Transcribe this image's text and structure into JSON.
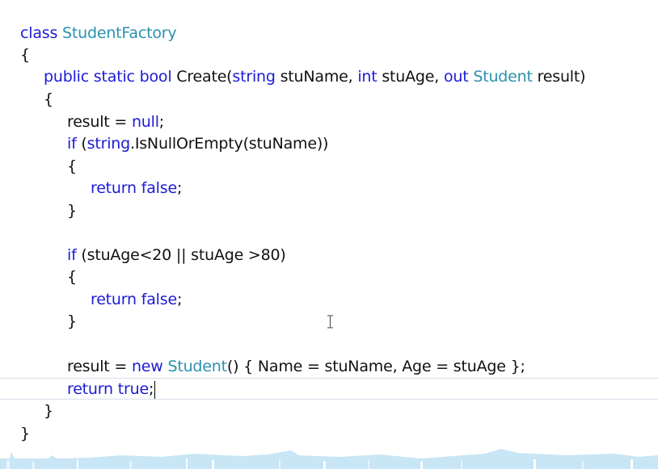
{
  "editor": {
    "lines": [
      [
        {
          "t": "class ",
          "k": "keyword"
        },
        {
          "t": "StudentFactory",
          "k": "type"
        }
      ],
      [
        {
          "t": "{",
          "k": "plain"
        }
      ],
      [
        {
          "t": "public static bool ",
          "k": "keyword"
        },
        {
          "t": "Create(",
          "k": "plain"
        },
        {
          "t": "string ",
          "k": "keyword"
        },
        {
          "t": "stuName, ",
          "k": "plain"
        },
        {
          "t": "int ",
          "k": "keyword"
        },
        {
          "t": "stuAge, ",
          "k": "plain"
        },
        {
          "t": "out ",
          "k": "keyword"
        },
        {
          "t": "Student ",
          "k": "type"
        },
        {
          "t": "result)",
          "k": "plain"
        }
      ],
      [
        {
          "t": "{",
          "k": "plain"
        }
      ],
      [
        {
          "t": "result = ",
          "k": "plain"
        },
        {
          "t": "null",
          "k": "keyword"
        },
        {
          "t": ";",
          "k": "plain"
        }
      ],
      [
        {
          "t": "if ",
          "k": "keyword"
        },
        {
          "t": "(",
          "k": "plain"
        },
        {
          "t": "string",
          "k": "keyword"
        },
        {
          "t": ".IsNullOrEmpty(stuName))",
          "k": "plain"
        }
      ],
      [
        {
          "t": "{",
          "k": "plain"
        }
      ],
      [
        {
          "t": "return false",
          "k": "keyword"
        },
        {
          "t": ";",
          "k": "plain"
        }
      ],
      [
        {
          "t": "}",
          "k": "plain"
        }
      ],
      [],
      [
        {
          "t": "if ",
          "k": "keyword"
        },
        {
          "t": "(stuAge<20 || stuAge >80)",
          "k": "plain"
        }
      ],
      [
        {
          "t": "{",
          "k": "plain"
        }
      ],
      [
        {
          "t": "return false",
          "k": "keyword"
        },
        {
          "t": ";",
          "k": "plain"
        }
      ],
      [
        {
          "t": "}",
          "k": "plain"
        }
      ],
      [],
      [
        {
          "t": "result = ",
          "k": "plain"
        },
        {
          "t": "new ",
          "k": "keyword"
        },
        {
          "t": "Student",
          "k": "type"
        },
        {
          "t": "() { Name = stuName, Age = stuAge };",
          "k": "plain"
        }
      ],
      [
        {
          "t": "return true",
          "k": "keyword"
        },
        {
          "t": ";",
          "k": "plain"
        }
      ],
      [
        {
          "t": "}",
          "k": "plain"
        }
      ],
      [
        {
          "t": "}",
          "k": "plain"
        }
      ]
    ],
    "current_line": 16,
    "colors": {
      "keyword": "#1b1bd6",
      "type": "#2b91af",
      "plain": "#111111",
      "background": "#ffffff",
      "current_line_border": "#d9dde8"
    },
    "cursor_icon": "ibeam-cursor-icon"
  }
}
